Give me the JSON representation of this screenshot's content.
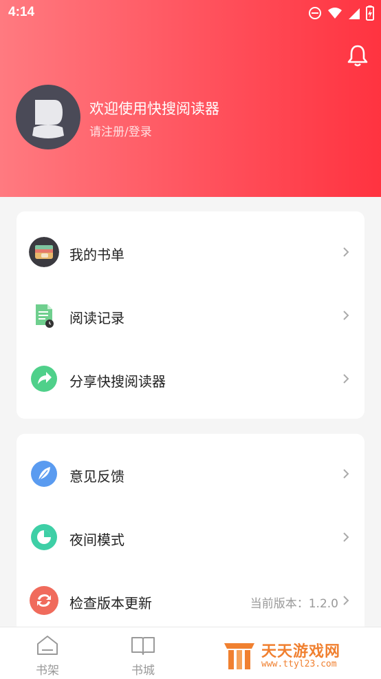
{
  "status_bar": {
    "time": "4:14"
  },
  "header": {
    "welcome": "欢迎使用快搜阅读器",
    "login": "请注册/登录"
  },
  "menu_group_1": [
    {
      "label": "我的书单",
      "icon": "booklist-wallet-icon"
    },
    {
      "label": "阅读记录",
      "icon": "reading-history-icon"
    },
    {
      "label": "分享快搜阅读器",
      "icon": "share-icon"
    }
  ],
  "menu_group_2": [
    {
      "label": "意见反馈",
      "icon": "feedback-feather-icon"
    },
    {
      "label": "夜间模式",
      "icon": "night-mode-icon"
    },
    {
      "label": "检查版本更新",
      "icon": "update-refresh-icon",
      "value": "当前版本：1.2.0"
    }
  ],
  "tab_bar": [
    {
      "label": "书架",
      "icon": "bookshelf-icon"
    },
    {
      "label": "书城",
      "icon": "bookstore-icon"
    }
  ],
  "watermark": {
    "text": "天天游戏网",
    "url": "www.ttyl23.com"
  },
  "colors": {
    "header_start": "#ff7a80",
    "header_end": "#ff3340",
    "accent": "#ff4650"
  }
}
